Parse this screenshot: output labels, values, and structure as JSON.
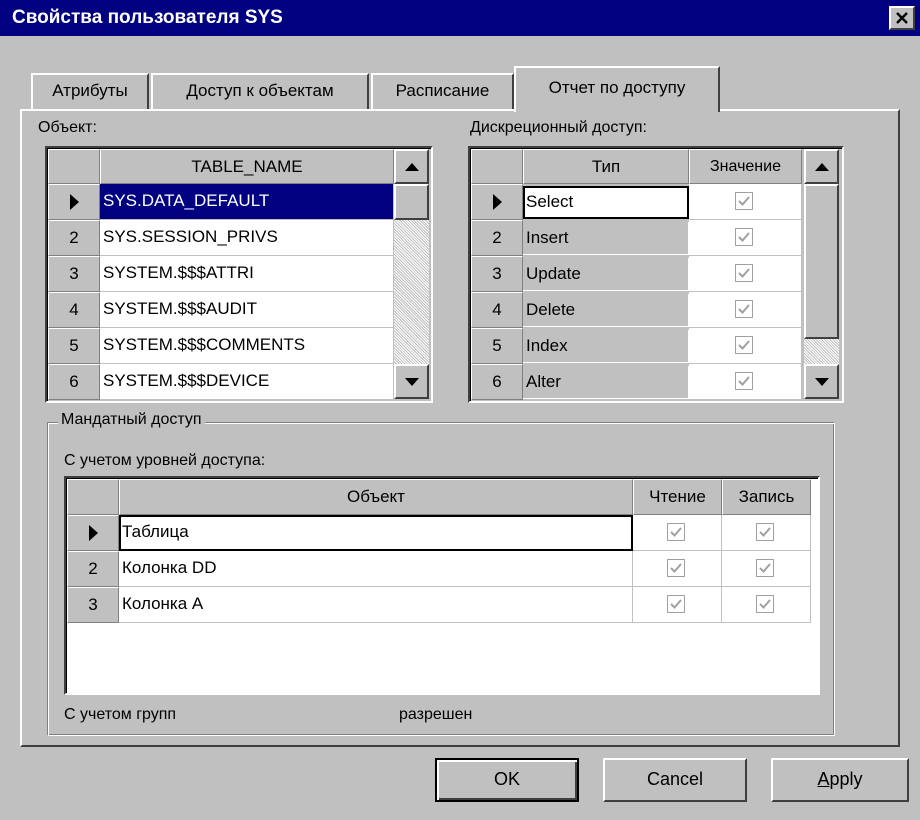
{
  "window": {
    "title": "Свойства пользователя SYS"
  },
  "tabs": [
    {
      "label": "Атрибуты"
    },
    {
      "label": "Доступ к объектам"
    },
    {
      "label": "Расписание"
    },
    {
      "label": "Отчет по доступу"
    }
  ],
  "objects_panel": {
    "label": "Объект:",
    "header": "TABLE_NAME",
    "rows": [
      {
        "indicator": "▶",
        "name": "SYS.DATA_DEFAULT"
      },
      {
        "indicator": "2",
        "name": "SYS.SESSION_PRIVS"
      },
      {
        "indicator": "3",
        "name": "SYSTEM.$$$ATTRI"
      },
      {
        "indicator": "4",
        "name": "SYSTEM.$$$AUDIT"
      },
      {
        "indicator": "5",
        "name": "SYSTEM.$$$COMMENTS"
      },
      {
        "indicator": "6",
        "name": "SYSTEM.$$$DEVICE"
      }
    ]
  },
  "discretionary_panel": {
    "label": "Дискреционный доступ:",
    "headers": {
      "type": "Тип",
      "value": "Значение"
    },
    "rows": [
      {
        "indicator": "▶",
        "type": "Select",
        "checked": true
      },
      {
        "indicator": "2",
        "type": "Insert",
        "checked": true
      },
      {
        "indicator": "3",
        "type": "Update",
        "checked": true
      },
      {
        "indicator": "4",
        "type": "Delete",
        "checked": true
      },
      {
        "indicator": "5",
        "type": "Index",
        "checked": true
      },
      {
        "indicator": "6",
        "type": "Alter",
        "checked": true
      }
    ]
  },
  "mandatory_group": {
    "title": "Мандатный доступ",
    "levels_label": "С учетом уровней доступа:",
    "headers": {
      "object": "Объект",
      "read": "Чтение",
      "write": "Запись"
    },
    "rows": [
      {
        "indicator": "▶",
        "object": "Таблица",
        "read": true,
        "write": true
      },
      {
        "indicator": "2",
        "object": "Колонка DD",
        "read": true,
        "write": true
      },
      {
        "indicator": "3",
        "object": "Колонка A",
        "read": true,
        "write": true
      }
    ],
    "groups_label": "С учетом групп",
    "groups_value": "разрешен"
  },
  "buttons": {
    "ok": "OK",
    "cancel": "Cancel",
    "apply": "Apply"
  },
  "colors": {
    "face": "#c0c0c0",
    "title_bar": "#000080",
    "selection": "#000080",
    "check": "#a0a0a0"
  },
  "icons": [
    "close-icon",
    "scroll-up-icon",
    "scroll-down-icon",
    "row-pointer-icon",
    "checkmark-icon"
  ]
}
